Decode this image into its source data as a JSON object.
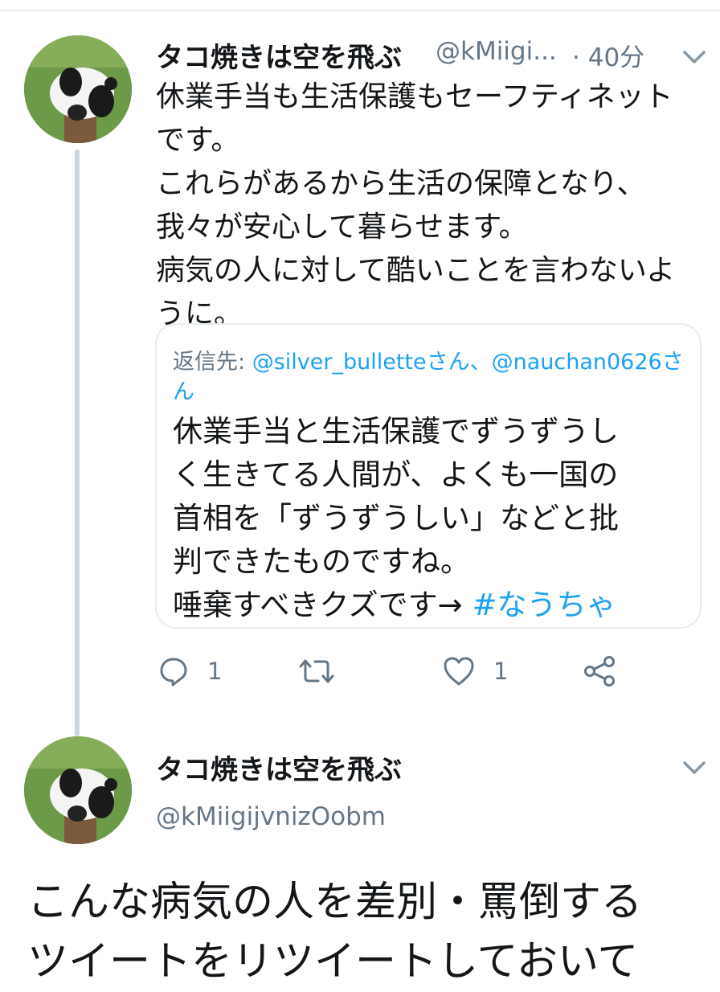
{
  "tweet1": {
    "display_name": "タコ焼きは空を飛ぶ",
    "handle": "@kMiigi...",
    "separator": "·",
    "time": "40分",
    "text": "休業手当も生活保護もセーフティネット\nです。\nこれらがあるから生活の保障となり、\n我々が安心して暮らせます。\n病気の人に対して酷いことを言わないよ\nうに。",
    "quoted": {
      "reply_prefix": "返信先: ",
      "reply_user1": "@silver_bulletteさん",
      "reply_sep": "、",
      "reply_user2": "@nauchan0626さん",
      "text": "休業手当と生活保護でずうずうし\nく生きてる人間が、よくも一国の\n首相を「ずうずうしい」などと批\n判できたものですね。\n唾棄すべきクズです→ ",
      "hashtag": "#なうちゃ"
    },
    "actions": {
      "reply_count": "1",
      "retweet_count": "",
      "like_count": "1"
    }
  },
  "tweet2": {
    "display_name": "タコ焼きは空を飛ぶ",
    "handle": "@kMiigijvnizOobm",
    "text": "こんな病気の人を差別・罵倒する\nツイートをリツイートしておいて"
  },
  "icons": {
    "avatar": "panda-avatar",
    "menu": "chevron-down-icon",
    "reply": "reply-icon",
    "retweet": "retweet-icon",
    "like": "heart-icon",
    "share": "share-icon"
  },
  "colors": {
    "link": "#1da1f2",
    "secondary": "#657786",
    "border": "#e6ecf0"
  }
}
